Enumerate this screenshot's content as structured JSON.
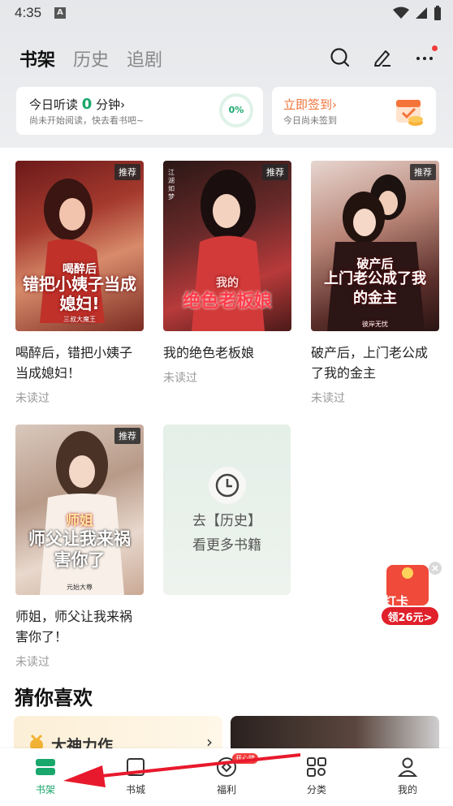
{
  "status_bar": {
    "time": "4:35",
    "notif_icon": "A"
  },
  "header": {
    "tabs": [
      {
        "label": "书架",
        "active": true
      },
      {
        "label": "历史",
        "active": false
      },
      {
        "label": "追剧",
        "active": false
      }
    ],
    "icons": [
      "search-icon",
      "edit-icon",
      "more-icon"
    ]
  },
  "listen_card": {
    "title_prefix": "今日听读",
    "minutes": "0",
    "title_suffix": "分钟",
    "chevron": "›",
    "subtitle": "尚未开始阅读，快去看书吧~",
    "progress": "0%"
  },
  "signin_card": {
    "title": "立即签到",
    "chevron": "›",
    "subtitle": "今日尚未签到"
  },
  "books": [
    {
      "badge": "推荐",
      "title": "喝醉后，错把小姨子当成媳妇！",
      "status": "未读过",
      "cover_top": "喝醉后",
      "cover_main": "错把小姨子当成媳妇!",
      "cover_author": "三叔大魔王"
    },
    {
      "badge": "推荐",
      "title": "我的绝色老板娘",
      "status": "未读过",
      "cover_top": "我的",
      "cover_main": "绝色老板娘",
      "cover_author": "江湖如梦"
    },
    {
      "badge": "推荐",
      "title": "破产后，上门老公成了我的金主",
      "status": "未读过",
      "cover_top": "破产后",
      "cover_main": "上门老公成了我的金主",
      "cover_author": "彼岸无忧"
    },
    {
      "badge": "推荐",
      "title": "师姐，师父让我来祸害你了！",
      "status": "未读过",
      "cover_top": "师姐",
      "cover_main": "师父让我来祸害你了",
      "cover_author": "元始大尊"
    }
  ],
  "history_card": {
    "line1": "去【历史】",
    "line2": "看更多书籍"
  },
  "promo": {
    "line1": "打卡",
    "line2": "领26元>"
  },
  "recommend": {
    "title": "猜你喜欢",
    "card1_title": "大神力作",
    "chevron": "›"
  },
  "nav": [
    {
      "label": "书架",
      "icon": "bookshelf-icon",
      "active": true
    },
    {
      "label": "书城",
      "icon": "bookstore-icon",
      "active": false
    },
    {
      "label": "福利",
      "icon": "welfare-icon",
      "active": false,
      "badge": "开心赚"
    },
    {
      "label": "分类",
      "icon": "category-icon",
      "active": false
    },
    {
      "label": "我的",
      "icon": "profile-icon",
      "active": false
    }
  ],
  "colors": {
    "accent": "#19a76b",
    "orange": "#f0733a",
    "red": "#e0202a"
  }
}
